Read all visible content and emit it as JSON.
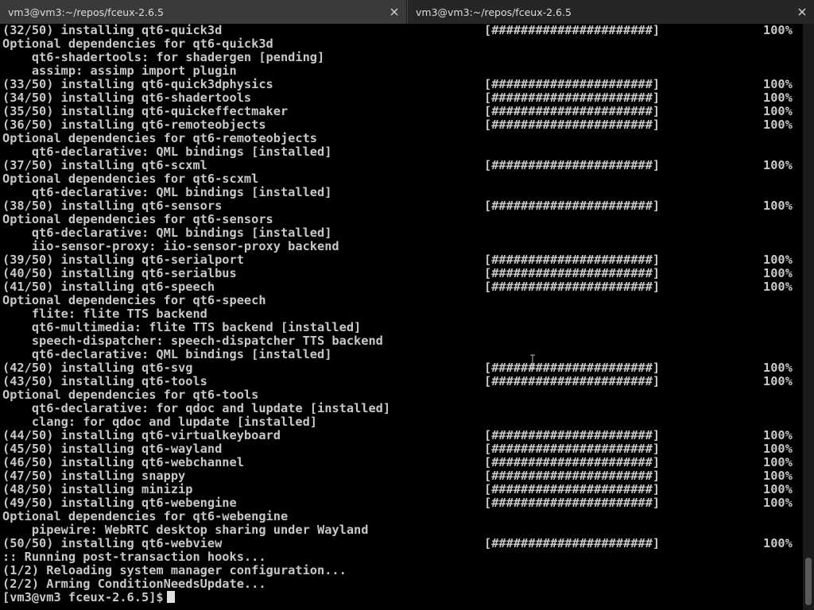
{
  "tabs": [
    {
      "title": "vm3@vm3:~/repos/fceux-2.6.5",
      "active": true
    },
    {
      "title": "vm3@vm3:~/repos/fceux-2.6.5",
      "active": false
    }
  ],
  "terminal": {
    "lines": [
      {
        "text": "(32/50) installing qt6-quick3d",
        "bar": "[######################]",
        "pct": "100%"
      },
      {
        "text": "Optional dependencies for qt6-quick3d"
      },
      {
        "text": "    qt6-shadertools: for shadergen [pending]"
      },
      {
        "text": "    assimp: assimp import plugin"
      },
      {
        "text": "(33/50) installing qt6-quick3dphysics",
        "bar": "[######################]",
        "pct": "100%"
      },
      {
        "text": "(34/50) installing qt6-shadertools",
        "bar": "[######################]",
        "pct": "100%"
      },
      {
        "text": "(35/50) installing qt6-quickeffectmaker",
        "bar": "[######################]",
        "pct": "100%"
      },
      {
        "text": "(36/50) installing qt6-remoteobjects",
        "bar": "[######################]",
        "pct": "100%"
      },
      {
        "text": "Optional dependencies for qt6-remoteobjects"
      },
      {
        "text": "    qt6-declarative: QML bindings [installed]"
      },
      {
        "text": "(37/50) installing qt6-scxml",
        "bar": "[######################]",
        "pct": "100%"
      },
      {
        "text": "Optional dependencies for qt6-scxml"
      },
      {
        "text": "    qt6-declarative: QML bindings [installed]"
      },
      {
        "text": "(38/50) installing qt6-sensors",
        "bar": "[######################]",
        "pct": "100%"
      },
      {
        "text": "Optional dependencies for qt6-sensors"
      },
      {
        "text": "    qt6-declarative: QML bindings [installed]"
      },
      {
        "text": "    iio-sensor-proxy: iio-sensor-proxy backend"
      },
      {
        "text": "(39/50) installing qt6-serialport",
        "bar": "[######################]",
        "pct": "100%"
      },
      {
        "text": "(40/50) installing qt6-serialbus",
        "bar": "[######################]",
        "pct": "100%"
      },
      {
        "text": "(41/50) installing qt6-speech",
        "bar": "[######################]",
        "pct": "100%"
      },
      {
        "text": "Optional dependencies for qt6-speech"
      },
      {
        "text": "    flite: flite TTS backend"
      },
      {
        "text": "    qt6-multimedia: flite TTS backend [installed]"
      },
      {
        "text": "    speech-dispatcher: speech-dispatcher TTS backend"
      },
      {
        "text": "    qt6-declarative: QML bindings [installed]"
      },
      {
        "text": "(42/50) installing qt6-svg",
        "bar": "[######################]",
        "pct": "100%"
      },
      {
        "text": "(43/50) installing qt6-tools",
        "bar": "[######################]",
        "pct": "100%"
      },
      {
        "text": "Optional dependencies for qt6-tools"
      },
      {
        "text": "    qt6-declarative: for qdoc and lupdate [installed]"
      },
      {
        "text": "    clang: for qdoc and lupdate [installed]"
      },
      {
        "text": "(44/50) installing qt6-virtualkeyboard",
        "bar": "[######################]",
        "pct": "100%"
      },
      {
        "text": "(45/50) installing qt6-wayland",
        "bar": "[######################]",
        "pct": "100%"
      },
      {
        "text": "(46/50) installing qt6-webchannel",
        "bar": "[######################]",
        "pct": "100%"
      },
      {
        "text": "(47/50) installing snappy",
        "bar": "[######################]",
        "pct": "100%"
      },
      {
        "text": "(48/50) installing minizip",
        "bar": "[######################]",
        "pct": "100%"
      },
      {
        "text": "(49/50) installing qt6-webengine",
        "bar": "[######################]",
        "pct": "100%"
      },
      {
        "text": "Optional dependencies for qt6-webengine"
      },
      {
        "text": "    pipewire: WebRTC desktop sharing under Wayland"
      },
      {
        "text": "(50/50) installing qt6-webview",
        "bar": "[######################]",
        "pct": "100%"
      },
      {
        "text": ":: Running post-transaction hooks..."
      },
      {
        "text": "(1/2) Reloading system manager configuration..."
      },
      {
        "text": "(2/2) Arming ConditionNeedsUpdate..."
      }
    ],
    "prompt": "[vm3@vm3 fceux-2.6.5]$"
  }
}
